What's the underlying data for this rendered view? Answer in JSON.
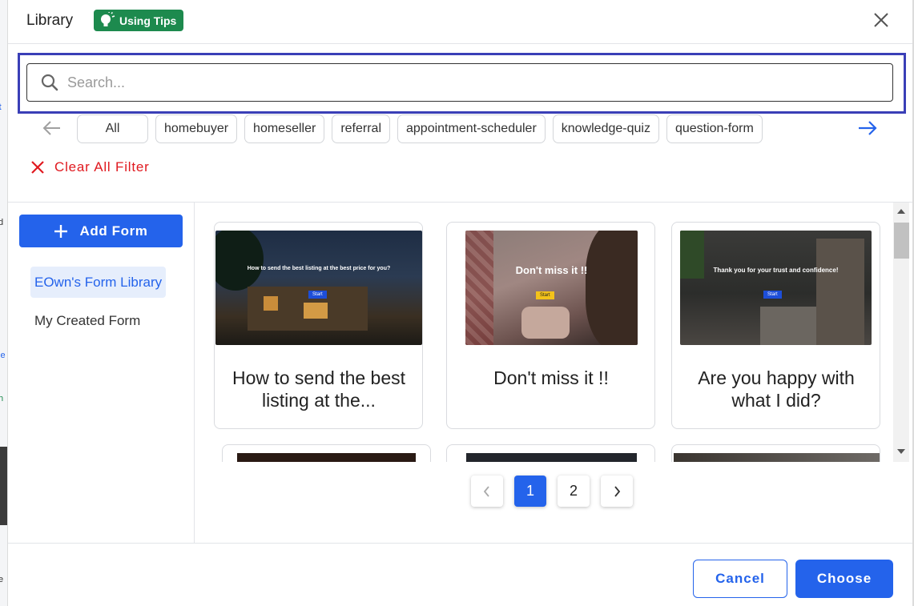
{
  "header": {
    "title": "Library",
    "tips_label": "Using Tips"
  },
  "search": {
    "placeholder": "Search...",
    "value": ""
  },
  "filters": {
    "chips": [
      "All",
      "homebuyer",
      "homeseller",
      "referral",
      "appointment-scheduler",
      "knowledge-quiz",
      "question-form"
    ],
    "clear_label": "Clear All Filter"
  },
  "sidebar": {
    "add_label": "Add Form",
    "items": [
      {
        "label": "EOwn's Form Library",
        "active": true
      },
      {
        "label": "My Created Form",
        "active": false
      }
    ]
  },
  "cards": [
    {
      "title": "How to send the best listing at the...",
      "thumb_heading": "How to send the best listing at the best price for you?",
      "thumb_button": "Start"
    },
    {
      "title": "Don't miss it !!",
      "thumb_heading": "Don't miss it !!",
      "thumb_button": "Start"
    },
    {
      "title": "Are you happy with what I did?",
      "thumb_heading": "Thank you for your trust and confidence!",
      "thumb_button": "Start"
    }
  ],
  "pagination": {
    "pages": [
      "1",
      "2"
    ],
    "current": "1"
  },
  "footer": {
    "cancel_label": "Cancel",
    "choose_label": "Choose"
  },
  "colors": {
    "primary": "#2463eb",
    "tips_green": "#1d8a4e",
    "danger": "#e0191f",
    "focus_outline": "#3a3fb7"
  }
}
